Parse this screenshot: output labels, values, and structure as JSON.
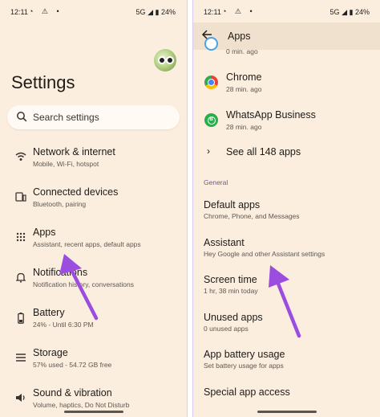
{
  "left": {
    "status": {
      "time": "12:11",
      "network": "5G",
      "battery": "24%"
    },
    "title": "Settings",
    "search": {
      "placeholder": "Search settings"
    },
    "items": [
      {
        "icon": "wifi-icon",
        "title": "Network & internet",
        "subtitle": "Mobile, Wi-Fi, hotspot"
      },
      {
        "icon": "devices-icon",
        "title": "Connected devices",
        "subtitle": "Bluetooth, pairing"
      },
      {
        "icon": "apps-grid-icon",
        "title": "Apps",
        "subtitle": "Assistant, recent apps, default apps"
      },
      {
        "icon": "bell-icon",
        "title": "Notifications",
        "subtitle": "Notification history, conversations"
      },
      {
        "icon": "battery-icon",
        "title": "Battery",
        "subtitle": "24% - Until 6:30 PM"
      },
      {
        "icon": "storage-icon",
        "title": "Storage",
        "subtitle": "57% used - 54.72 GB free"
      },
      {
        "icon": "speaker-icon",
        "title": "Sound & vibration",
        "subtitle": "Volume, haptics, Do Not Disturb"
      }
    ]
  },
  "right": {
    "status": {
      "time": "12:11",
      "network": "5G",
      "battery": "24%"
    },
    "title": "Apps",
    "recent": [
      {
        "icon": "app-icon",
        "title": "",
        "subtitle": "0 min. ago"
      },
      {
        "icon": "chrome-icon",
        "title": "Chrome",
        "subtitle": "28 min. ago"
      },
      {
        "icon": "whatsapp-business-icon",
        "title": "WhatsApp Business",
        "subtitle": "28 min. ago"
      }
    ],
    "see_all": "See all 148 apps",
    "section": "General",
    "items": [
      {
        "title": "Default apps",
        "subtitle": "Chrome, Phone, and Messages"
      },
      {
        "title": "Assistant",
        "subtitle": "Hey Google and other Assistant settings"
      },
      {
        "title": "Screen time",
        "subtitle": "1 hr, 38 min today"
      },
      {
        "title": "Unused apps",
        "subtitle": "0 unused apps"
      },
      {
        "title": "App battery usage",
        "subtitle": "Set battery usage for apps"
      },
      {
        "title": "Special app access",
        "subtitle": ""
      }
    ]
  },
  "colors": {
    "background": "#fbeedf",
    "accent_arrow": "#9b4de0",
    "topbar": "#f0e1cf"
  }
}
